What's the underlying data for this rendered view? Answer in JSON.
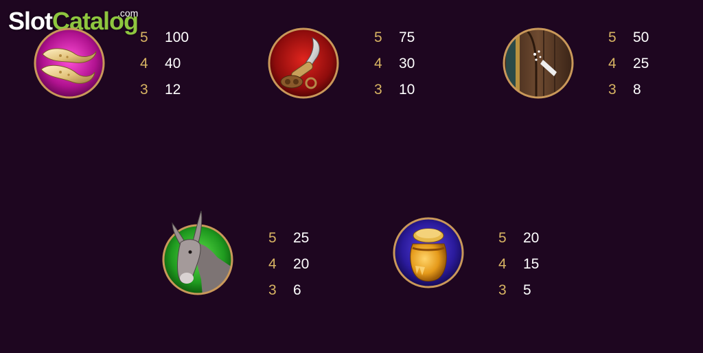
{
  "watermark": {
    "brand_a": "Slot",
    "brand_b": "Catalog",
    "suffix": ".com"
  },
  "colors": {
    "background": "#1e0620",
    "count": "#d8b463",
    "value": "#ffffff",
    "frame": "#c9985a"
  },
  "paytable": [
    {
      "symbol": "slippers",
      "icon": "slippers-icon",
      "pays": [
        {
          "count": "5",
          "value": "100"
        },
        {
          "count": "4",
          "value": "40"
        },
        {
          "count": "3",
          "value": "12"
        }
      ]
    },
    {
      "symbol": "dagger",
      "icon": "dagger-icon",
      "pays": [
        {
          "count": "5",
          "value": "75"
        },
        {
          "count": "4",
          "value": "30"
        },
        {
          "count": "3",
          "value": "10"
        }
      ]
    },
    {
      "symbol": "door",
      "icon": "door-icon",
      "pays": [
        {
          "count": "5",
          "value": "50"
        },
        {
          "count": "4",
          "value": "25"
        },
        {
          "count": "3",
          "value": "8"
        }
      ]
    },
    {
      "symbol": "donkey",
      "icon": "donkey-icon",
      "pays": [
        {
          "count": "5",
          "value": "25"
        },
        {
          "count": "4",
          "value": "20"
        },
        {
          "count": "3",
          "value": "6"
        }
      ]
    },
    {
      "symbol": "honey-pot",
      "icon": "honey-pot-icon",
      "pays": [
        {
          "count": "5",
          "value": "20"
        },
        {
          "count": "4",
          "value": "15"
        },
        {
          "count": "3",
          "value": "5"
        }
      ]
    }
  ]
}
